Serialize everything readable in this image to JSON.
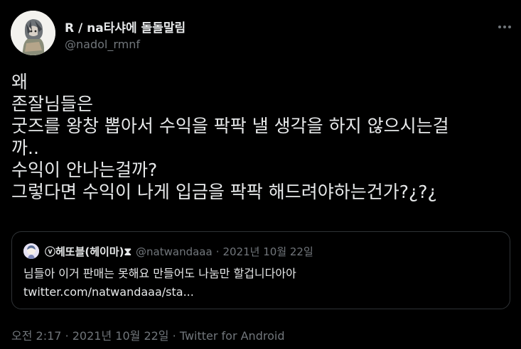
{
  "author": {
    "display_name": "R / na타샤에 돌돌말림",
    "handle": "@nadol_rmnf",
    "avatar_icon": "anime-character-avatar"
  },
  "menu": {
    "more_icon": "more-horizontal-icon"
  },
  "tweet": {
    "lines": [
      "왜",
      "존잘님들은",
      "굿즈를 왕창 뽑아서 수익을 팍팍 낼 생각을 하지 않으시는걸",
      "까..",
      "수익이 안나는걸까?",
      "그렇다면 수익이 나게 입금을 팍팍 해드려야하는건가?¿?¿"
    ]
  },
  "quoted_tweet": {
    "display_name": "ⓥ헤또블(헤이마)⧗",
    "handle": "@natwandaaa",
    "separator": "·",
    "date": "2021년 10월 22일",
    "text": "님들아 이거 판매는 못해요 만들어도 나눔만 할겁니다아아",
    "link": "twitter.com/natwandaaa/sta..."
  },
  "meta": {
    "time": "오전 2:17",
    "sep1": "·",
    "date": "2021년 10월 22일",
    "sep2": "·",
    "source": "Twitter for Android"
  },
  "colors": {
    "background": "#000000",
    "text_primary": "#e7e9ea",
    "text_secondary": "#71767b",
    "border": "#2f3336"
  }
}
